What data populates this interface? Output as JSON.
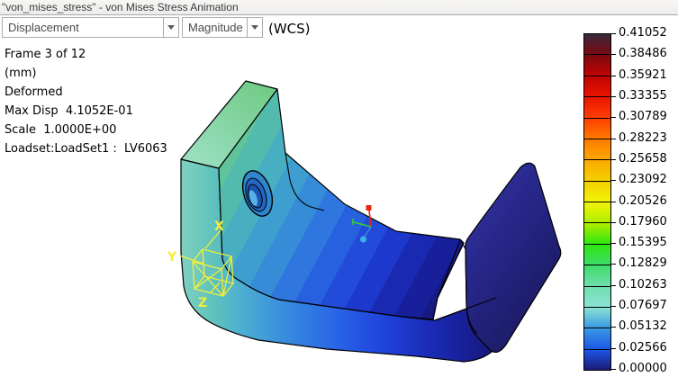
{
  "window": {
    "title": "\"von_mises_stress\" - von Mises Stress Animation"
  },
  "toolbar": {
    "quantity_value": "Displacement",
    "component_value": "Magnitude",
    "csys_label": "(WCS)"
  },
  "info_lines": [
    "Frame 3 of 12",
    "(mm)",
    "Deformed",
    "Max Disp  4.1052E-01",
    "Scale  1.0000E+00",
    "Loadset:LoadSet1 :  LV6063"
  ],
  "legend": {
    "values": [
      "0.41052",
      "0.38486",
      "0.35921",
      "0.33355",
      "0.30789",
      "0.28223",
      "0.25658",
      "0.23092",
      "0.20526",
      "0.17960",
      "0.15395",
      "0.12829",
      "0.10263",
      "0.07697",
      "0.05132",
      "0.02566",
      "0.00000"
    ],
    "band_boundary_colors": [
      "#3a2a3c",
      "#79090f",
      "#c20404",
      "#e81400",
      "#ff3f00",
      "#ff7a00",
      "#fca700",
      "#f4d100",
      "#f2f307",
      "#b0ee00",
      "#2ee70f",
      "#3edc68",
      "#70dfae",
      "#8be2d4",
      "#3a9ae4",
      "#1c56e8",
      "#1b1b74"
    ]
  },
  "model": {
    "constraint_axes": [
      "X",
      "Y",
      "Z"
    ],
    "colors": {
      "constraint_yellow": "#f4ee38",
      "triad_x_red": "#e82812",
      "triad_y_green": "#2fd32f",
      "triad_z_blue": "#3b82d8",
      "max_region_teal": "#5fc49a",
      "min_region_navy": "#16166c"
    }
  }
}
